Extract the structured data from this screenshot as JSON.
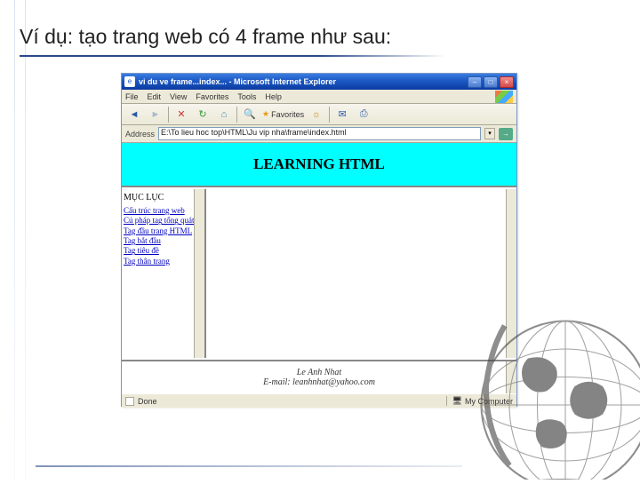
{
  "slide": {
    "title": "Ví dụ: tạo trang web có 4 frame như sau:"
  },
  "window": {
    "title": "vi du ve frame...index... - Microsoft Internet Explorer",
    "menus": {
      "file": "File",
      "edit": "Edit",
      "view": "View",
      "favorites": "Favorites",
      "tools": "Tools",
      "help": "Help"
    },
    "toolbar": {
      "favorites": "Favorites"
    },
    "address": {
      "label": "Address",
      "value": "E:\\To lieu hoc top\\HTML\\Ju vip nha\\frame\\index.html"
    },
    "status": {
      "done": "Done",
      "zone": "My Computer"
    }
  },
  "frames": {
    "top": {
      "heading": "LEARNING HTML"
    },
    "left": {
      "heading": "MỤC LỤC",
      "items": [
        "Cấu trúc trang web",
        "Cú pháp tag tổng quát",
        "Tag đầu trang HTML",
        "Tag bắt đầu",
        "Tag tiêu đề",
        "Tag thân trang"
      ]
    },
    "bottom": {
      "author": "Le Anh Nhat",
      "email": "E-mail: leanhnhat@yahoo.com"
    }
  }
}
